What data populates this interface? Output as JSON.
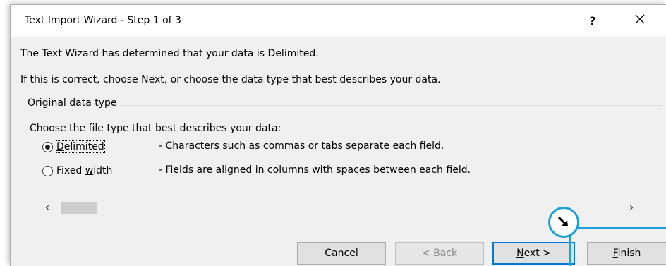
{
  "window": {
    "title": "Text Import Wizard - Step 1 of 3",
    "help_glyph": "?",
    "close_glyph": "✕"
  },
  "intro": {
    "line1": "The Text Wizard has determined that your data is Delimited.",
    "line2": "If this is correct, choose Next, or choose the data type that best describes your data."
  },
  "group": {
    "legend": "Original data type",
    "prompt": "Choose the file type that best describes your data:",
    "options": [
      {
        "label_pre": "",
        "label_key": "D",
        "label_post": "elimited",
        "description": "- Characters such as commas or tabs separate each field.",
        "selected": true
      },
      {
        "label_pre": "Fixed ",
        "label_key": "w",
        "label_post": "idth",
        "description": "- Fields are aligned in columns with spaces between each field.",
        "selected": false
      }
    ]
  },
  "scroll": {
    "left_glyph": "‹",
    "right_glyph": "›"
  },
  "buttons": {
    "cancel": "Cancel",
    "back": "< Back",
    "next_key": "N",
    "next_rest": "ext >",
    "finish_key": "F",
    "finish_rest": "inish"
  },
  "colors": {
    "accent": "#0078d7",
    "highlight": "#1ea0d8"
  }
}
